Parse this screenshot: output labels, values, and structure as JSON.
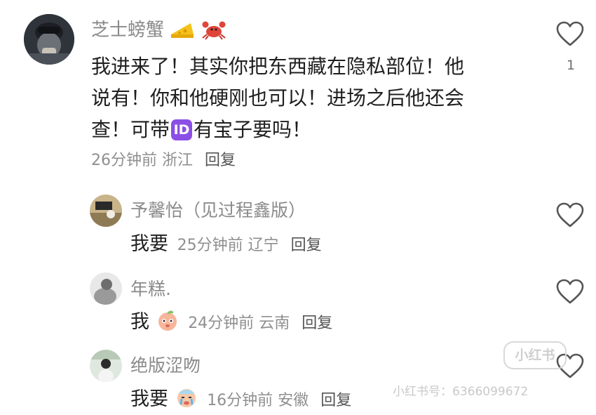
{
  "comment": {
    "author": "芝士螃蟹",
    "author_icons": [
      "cheese-icon",
      "crab-icon"
    ],
    "text_line1": "我进来了！其实你把东西藏在隐私部位！他",
    "text_line2": "说有！你和他硬刚也可以！进场之后他还会",
    "text_line3_prefix": "查！可带",
    "text_badge": "ID",
    "text_line3_suffix": "有宝子要吗！",
    "time": "26分钟前",
    "location": "浙江",
    "reply_label": "回复",
    "like_count": "1"
  },
  "replies": [
    {
      "author": "予馨怡（见过程鑫版）",
      "text": "我要",
      "emoji": "",
      "time": "25分钟前",
      "location": "辽宁",
      "reply_label": "回复"
    },
    {
      "author": "年糕.",
      "text": "我",
      "emoji": "peach-face-emoji",
      "time": "24分钟前",
      "location": "云南",
      "reply_label": "回复"
    },
    {
      "author": "绝版涩吻",
      "text": "我要",
      "emoji": "crying-face-emoji",
      "time": "16分钟前",
      "location": "安徽",
      "reply_label": "回复"
    }
  ],
  "watermark": {
    "logo_text": "小红书",
    "id_text": "小红书号：6366099672"
  },
  "colors": {
    "name": "#8a8a8a",
    "text": "#1f1f1f",
    "meta": "#8f8f8f",
    "badge": "#8c4fe6",
    "heart_stroke": "#555555"
  }
}
